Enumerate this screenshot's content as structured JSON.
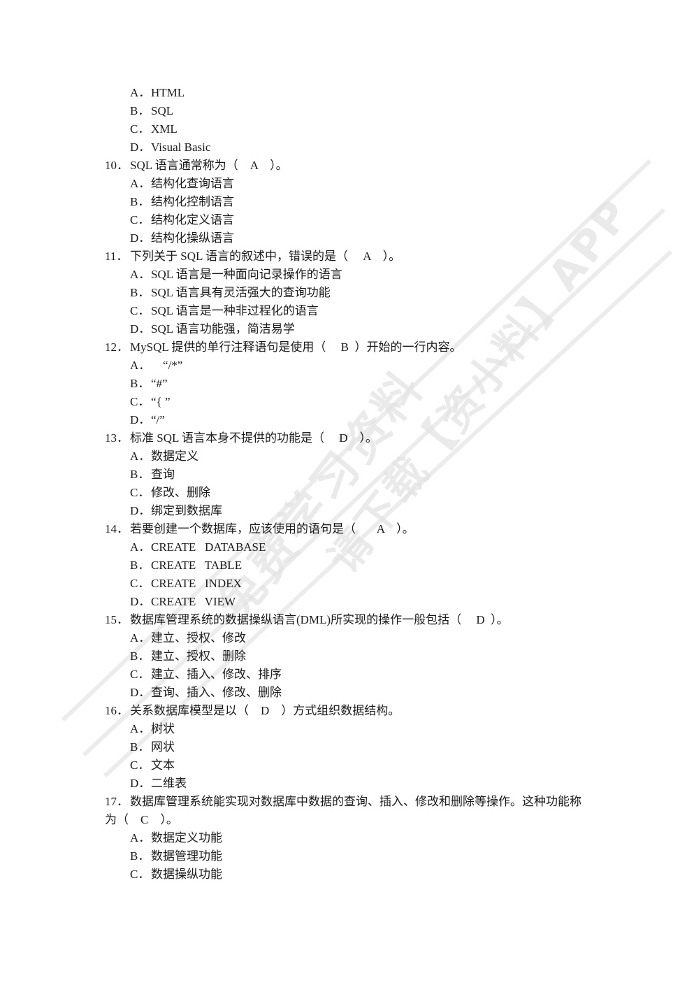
{
  "watermark": {
    "line1": "免费学习资料",
    "line2": "请下载【资小料】APP"
  },
  "items": [
    {
      "type": "option",
      "letter": "A．",
      "text": "HTML"
    },
    {
      "type": "option",
      "letter": "B．",
      "text": "SQL"
    },
    {
      "type": "option",
      "letter": "C．",
      "text": "XML"
    },
    {
      "type": "option",
      "letter": "D．",
      "text": "Visual Basic"
    },
    {
      "type": "question",
      "num": "10．",
      "text": "SQL 语言通常称为（    A    ）。"
    },
    {
      "type": "option",
      "letter": "A．",
      "text": "结构化查询语言"
    },
    {
      "type": "option",
      "letter": "B．",
      "text": "结构化控制语言"
    },
    {
      "type": "option",
      "letter": "C．",
      "text": "结构化定义语言"
    },
    {
      "type": "option",
      "letter": "D．",
      "text": "结构化操纵语言"
    },
    {
      "type": "question",
      "num": "11．",
      "text": "下列关于 SQL 语言的叙述中，错误的是（     A    ）。"
    },
    {
      "type": "option",
      "letter": "A．",
      "text": "SQL 语言是一种面向记录操作的语言"
    },
    {
      "type": "option",
      "letter": "B．",
      "text": "SQL 语言具有灵活强大的查询功能"
    },
    {
      "type": "option",
      "letter": "C．",
      "text": "SQL 语言是一种非过程化的语言"
    },
    {
      "type": "option",
      "letter": "D．",
      "text": "SQL 语言功能强，简洁易学"
    },
    {
      "type": "question",
      "num": "12．",
      "text": "MySQL 提供的单行注释语句是使用（     B  ）开始的一行内容。"
    },
    {
      "type": "option",
      "letter": "A．",
      "text": "    “/*”"
    },
    {
      "type": "option",
      "letter": "B．",
      "text": "“#”"
    },
    {
      "type": "option",
      "letter": "C．",
      "text": "“{ ”"
    },
    {
      "type": "option",
      "letter": "D．",
      "text": "“/”"
    },
    {
      "type": "question",
      "num": "13．",
      "text": "标准 SQL 语言本身不提供的功能是（     D    ）。"
    },
    {
      "type": "option",
      "letter": "A．",
      "text": "数据定义"
    },
    {
      "type": "option",
      "letter": "B．",
      "text": "查询"
    },
    {
      "type": "option",
      "letter": "C．",
      "text": "修改、删除"
    },
    {
      "type": "option",
      "letter": "D．",
      "text": "绑定到数据库"
    },
    {
      "type": "question",
      "num": "14．",
      "text": "若要创建一个数据库，应该使用的语句是（       A    ）。"
    },
    {
      "type": "option",
      "letter": "A．",
      "text": "CREATE   DATABASE"
    },
    {
      "type": "option",
      "letter": "B．",
      "text": "CREATE   TABLE"
    },
    {
      "type": "option",
      "letter": "C．",
      "text": "CREATE   INDEX"
    },
    {
      "type": "option",
      "letter": "D．",
      "text": "CREATE   VIEW"
    },
    {
      "type": "question",
      "num": "15．",
      "text": "数据库管理系统的数据操纵语言(DML)所实现的操作一般包括（     D  ）。"
    },
    {
      "type": "option",
      "letter": "A．",
      "text": "建立、授权、修改"
    },
    {
      "type": "option",
      "letter": "B．",
      "text": "建立、授权、删除"
    },
    {
      "type": "option",
      "letter": "C．",
      "text": "建立、插入、修改、排序"
    },
    {
      "type": "option",
      "letter": "D．",
      "text": "查询、插入、修改、删除"
    },
    {
      "type": "question",
      "num": "16．",
      "text": "关系数据库模型是以（    D    ）方式组织数据结构。"
    },
    {
      "type": "option",
      "letter": "A．",
      "text": "树状"
    },
    {
      "type": "option",
      "letter": "B．",
      "text": "网状"
    },
    {
      "type": "option",
      "letter": "C．",
      "text": "文本"
    },
    {
      "type": "option",
      "letter": "D．",
      "text": "二维表"
    },
    {
      "type": "question",
      "num": "17．",
      "text": "数据库管理系统能实现对数据库中数据的查询、插入、修改和删除等操作。这种功能称"
    },
    {
      "type": "continuation",
      "text": "为（    C    ）。"
    },
    {
      "type": "option",
      "letter": "A．",
      "text": "数据定义功能"
    },
    {
      "type": "option",
      "letter": "B．",
      "text": "数据管理功能"
    },
    {
      "type": "option",
      "letter": "C．",
      "text": "数据操纵功能"
    }
  ]
}
